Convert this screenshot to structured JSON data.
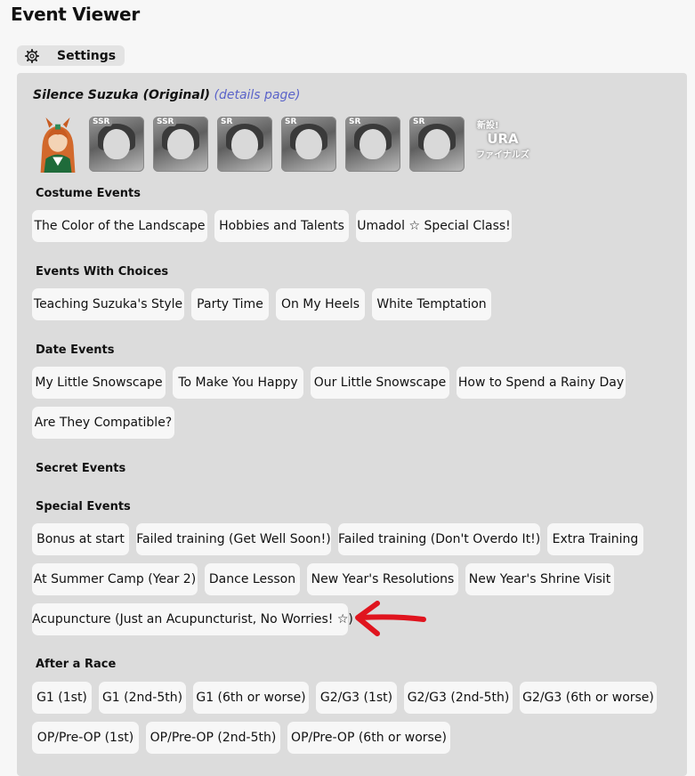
{
  "page": {
    "title": "Event Viewer"
  },
  "settings": {
    "label": "Settings"
  },
  "character": {
    "name": "Silence Suzuka (Original)",
    "details_link": "(details page)"
  },
  "support_cards": [
    {
      "rarity": "SSR"
    },
    {
      "rarity": "SSR"
    },
    {
      "rarity": "SR"
    },
    {
      "rarity": "SR"
    },
    {
      "rarity": "SR"
    },
    {
      "rarity": "SR"
    }
  ],
  "scenario": {
    "line1": "新設!",
    "line2": "URA",
    "line3": "ファイナルズ"
  },
  "sections": {
    "costume": {
      "title": "Costume Events",
      "events": [
        "The Color of the Landscape",
        "Hobbies and Talents",
        "Umadol ☆ Special Class!"
      ]
    },
    "choices": {
      "title": "Events With Choices",
      "events": [
        "Teaching Suzuka's Style",
        "Party Time",
        "On My Heels",
        "White Temptation"
      ]
    },
    "date": {
      "title": "Date Events",
      "events": [
        "My Little Snowscape",
        "To Make You Happy",
        "Our Little Snowscape",
        "How to Spend a Rainy Day",
        "Are They Compatible?"
      ]
    },
    "secret": {
      "title": "Secret Events"
    },
    "special": {
      "title": "Special Events",
      "events": [
        "Bonus at start",
        "Failed training (Get Well Soon!)",
        "Failed training (Don't Overdo It!)",
        "Extra Training",
        "At Summer Camp (Year 2)",
        "Dance Lesson",
        "New Year's Resolutions",
        "New Year's Shrine Visit",
        "Acupuncture (Just an Acupuncturist, No Worries! ☆)"
      ]
    },
    "race": {
      "title": "After a Race",
      "events": [
        "G1 (1st)",
        "G1 (2nd-5th)",
        "G1 (6th or worse)",
        "G2/G3 (1st)",
        "G2/G3 (2nd-5th)",
        "G2/G3 (6th or worse)",
        "OP/Pre-OP (1st)",
        "OP/Pre-OP (2nd-5th)",
        "OP/Pre-OP (6th or worse)"
      ]
    }
  },
  "annotation": {
    "arrow_color": "#e0141e"
  }
}
